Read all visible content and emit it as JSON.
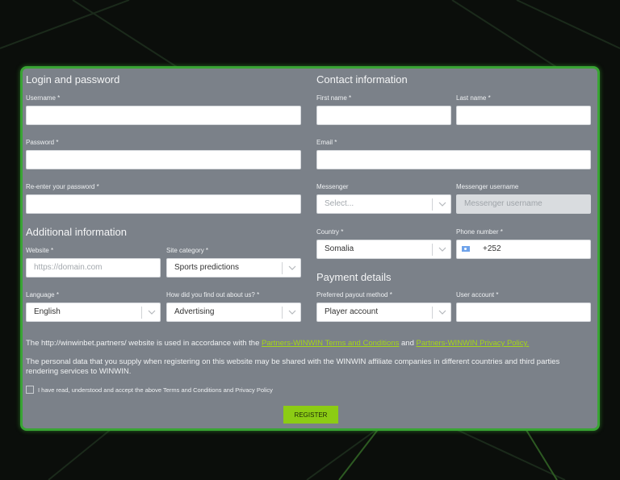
{
  "login": {
    "title": "Login and password",
    "username_label": "Username *",
    "password_label": "Password *",
    "reenter_label": "Re-enter your password *"
  },
  "contact": {
    "title": "Contact information",
    "first_name_label": "First name *",
    "last_name_label": "Last name *",
    "email_label": "Email *",
    "messenger_label": "Messenger",
    "messenger_value": "Select...",
    "messenger_username_label": "Messenger username",
    "messenger_username_placeholder": "Messenger username",
    "country_label": "Country *",
    "country_value": "Somalia",
    "phone_label": "Phone number *",
    "phone_value": "+252"
  },
  "additional": {
    "title": "Additional information",
    "website_label": "Website *",
    "website_placeholder": "https://domain.com",
    "site_category_label": "Site category *",
    "site_category_value": "Sports predictions",
    "language_label": "Language *",
    "language_value": "English",
    "how_found_label": "How did you find out about us? *",
    "how_found_value": "Advertising"
  },
  "payment": {
    "title": "Payment details",
    "payout_label": "Preferred payout method *",
    "payout_value": "Player account",
    "user_account_label": "User account *"
  },
  "legal": {
    "notice_prefix": "The http://winwinbet.partners/ website is used in accordance with the ",
    "terms_link": "Partners-WINWIN Terms and Conditions",
    "notice_and": " and ",
    "privacy_link": "Partners-WINWIN Privacy Policy.",
    "personal_data": "The personal data that you supply when registering on this website may be shared with the WINWIN affiliate companies in different countries and third parties rendering services to WINWIN.",
    "checkbox_label": "I have read, understood and accept the above Terms and Conditions and Privacy Policy"
  },
  "register_button": "REGISTER",
  "colors": {
    "panel": "#7b8189",
    "border": "#39a434",
    "accent": "#8ccc14",
    "link": "#a6d615"
  },
  "icons": [
    "chevron-down-icon",
    "somalia-flag-icon",
    "checkbox-icon"
  ]
}
